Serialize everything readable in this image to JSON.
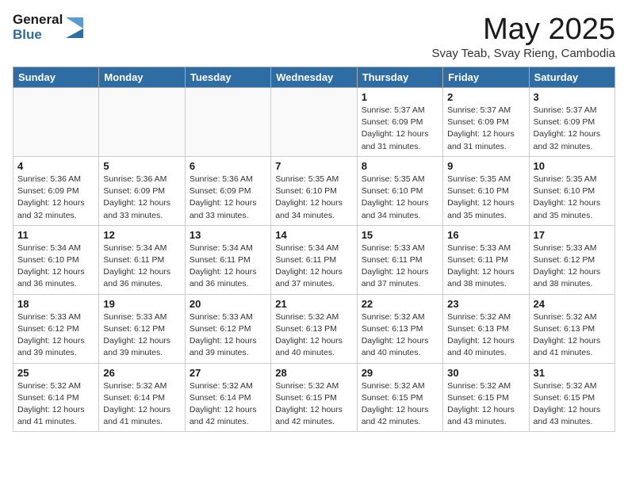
{
  "logo": {
    "text1": "General",
    "text2": "Blue"
  },
  "title": "May 2025",
  "subtitle": "Svay Teab, Svay Rieng, Cambodia",
  "days_header": [
    "Sunday",
    "Monday",
    "Tuesday",
    "Wednesday",
    "Thursday",
    "Friday",
    "Saturday"
  ],
  "weeks": [
    [
      {
        "day": "",
        "info": ""
      },
      {
        "day": "",
        "info": ""
      },
      {
        "day": "",
        "info": ""
      },
      {
        "day": "",
        "info": ""
      },
      {
        "day": "1",
        "info": "Sunrise: 5:37 AM\nSunset: 6:09 PM\nDaylight: 12 hours\nand 31 minutes."
      },
      {
        "day": "2",
        "info": "Sunrise: 5:37 AM\nSunset: 6:09 PM\nDaylight: 12 hours\nand 31 minutes."
      },
      {
        "day": "3",
        "info": "Sunrise: 5:37 AM\nSunset: 6:09 PM\nDaylight: 12 hours\nand 32 minutes."
      }
    ],
    [
      {
        "day": "4",
        "info": "Sunrise: 5:36 AM\nSunset: 6:09 PM\nDaylight: 12 hours\nand 32 minutes."
      },
      {
        "day": "5",
        "info": "Sunrise: 5:36 AM\nSunset: 6:09 PM\nDaylight: 12 hours\nand 33 minutes."
      },
      {
        "day": "6",
        "info": "Sunrise: 5:36 AM\nSunset: 6:09 PM\nDaylight: 12 hours\nand 33 minutes."
      },
      {
        "day": "7",
        "info": "Sunrise: 5:35 AM\nSunset: 6:10 PM\nDaylight: 12 hours\nand 34 minutes."
      },
      {
        "day": "8",
        "info": "Sunrise: 5:35 AM\nSunset: 6:10 PM\nDaylight: 12 hours\nand 34 minutes."
      },
      {
        "day": "9",
        "info": "Sunrise: 5:35 AM\nSunset: 6:10 PM\nDaylight: 12 hours\nand 35 minutes."
      },
      {
        "day": "10",
        "info": "Sunrise: 5:35 AM\nSunset: 6:10 PM\nDaylight: 12 hours\nand 35 minutes."
      }
    ],
    [
      {
        "day": "11",
        "info": "Sunrise: 5:34 AM\nSunset: 6:10 PM\nDaylight: 12 hours\nand 36 minutes."
      },
      {
        "day": "12",
        "info": "Sunrise: 5:34 AM\nSunset: 6:11 PM\nDaylight: 12 hours\nand 36 minutes."
      },
      {
        "day": "13",
        "info": "Sunrise: 5:34 AM\nSunset: 6:11 PM\nDaylight: 12 hours\nand 36 minutes."
      },
      {
        "day": "14",
        "info": "Sunrise: 5:34 AM\nSunset: 6:11 PM\nDaylight: 12 hours\nand 37 minutes."
      },
      {
        "day": "15",
        "info": "Sunrise: 5:33 AM\nSunset: 6:11 PM\nDaylight: 12 hours\nand 37 minutes."
      },
      {
        "day": "16",
        "info": "Sunrise: 5:33 AM\nSunset: 6:11 PM\nDaylight: 12 hours\nand 38 minutes."
      },
      {
        "day": "17",
        "info": "Sunrise: 5:33 AM\nSunset: 6:12 PM\nDaylight: 12 hours\nand 38 minutes."
      }
    ],
    [
      {
        "day": "18",
        "info": "Sunrise: 5:33 AM\nSunset: 6:12 PM\nDaylight: 12 hours\nand 39 minutes."
      },
      {
        "day": "19",
        "info": "Sunrise: 5:33 AM\nSunset: 6:12 PM\nDaylight: 12 hours\nand 39 minutes."
      },
      {
        "day": "20",
        "info": "Sunrise: 5:33 AM\nSunset: 6:12 PM\nDaylight: 12 hours\nand 39 minutes."
      },
      {
        "day": "21",
        "info": "Sunrise: 5:32 AM\nSunset: 6:13 PM\nDaylight: 12 hours\nand 40 minutes."
      },
      {
        "day": "22",
        "info": "Sunrise: 5:32 AM\nSunset: 6:13 PM\nDaylight: 12 hours\nand 40 minutes."
      },
      {
        "day": "23",
        "info": "Sunrise: 5:32 AM\nSunset: 6:13 PM\nDaylight: 12 hours\nand 40 minutes."
      },
      {
        "day": "24",
        "info": "Sunrise: 5:32 AM\nSunset: 6:13 PM\nDaylight: 12 hours\nand 41 minutes."
      }
    ],
    [
      {
        "day": "25",
        "info": "Sunrise: 5:32 AM\nSunset: 6:14 PM\nDaylight: 12 hours\nand 41 minutes."
      },
      {
        "day": "26",
        "info": "Sunrise: 5:32 AM\nSunset: 6:14 PM\nDaylight: 12 hours\nand 41 minutes."
      },
      {
        "day": "27",
        "info": "Sunrise: 5:32 AM\nSunset: 6:14 PM\nDaylight: 12 hours\nand 42 minutes."
      },
      {
        "day": "28",
        "info": "Sunrise: 5:32 AM\nSunset: 6:15 PM\nDaylight: 12 hours\nand 42 minutes."
      },
      {
        "day": "29",
        "info": "Sunrise: 5:32 AM\nSunset: 6:15 PM\nDaylight: 12 hours\nand 42 minutes."
      },
      {
        "day": "30",
        "info": "Sunrise: 5:32 AM\nSunset: 6:15 PM\nDaylight: 12 hours\nand 43 minutes."
      },
      {
        "day": "31",
        "info": "Sunrise: 5:32 AM\nSunset: 6:15 PM\nDaylight: 12 hours\nand 43 minutes."
      }
    ]
  ]
}
